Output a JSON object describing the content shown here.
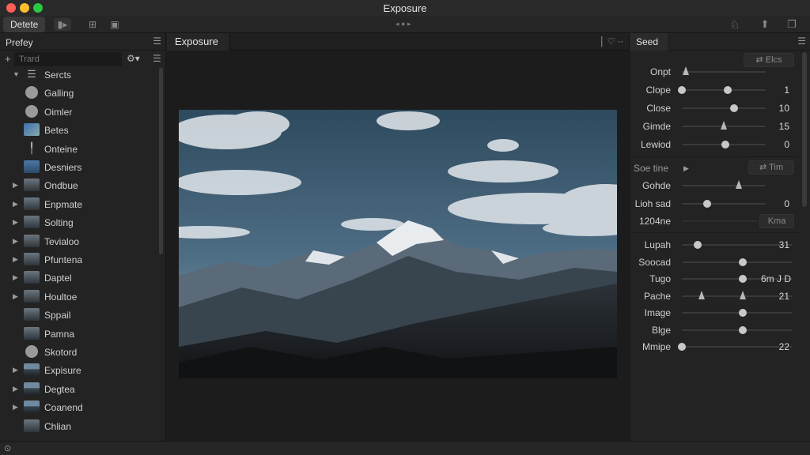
{
  "window": {
    "title": "Exposure"
  },
  "toolbar": {
    "tab_label": "Detete"
  },
  "library": {
    "title": "Prefey",
    "search": {
      "placeholder": "Trard"
    },
    "items": [
      {
        "label": "Sercts",
        "arrow": "down",
        "thumb": "list"
      },
      {
        "label": "Galling",
        "arrow": "",
        "thumb": "disc"
      },
      {
        "label": "Oimler",
        "arrow": "",
        "thumb": "disc"
      },
      {
        "label": "Betes",
        "arrow": "",
        "thumb": "cluster"
      },
      {
        "label": "Onteine",
        "arrow": "",
        "thumb": "pin"
      },
      {
        "label": "Desniers",
        "arrow": "",
        "thumb": "blue"
      },
      {
        "label": "Ondbue",
        "arrow": "right",
        "thumb": "photo"
      },
      {
        "label": "Enpmate",
        "arrow": "right",
        "thumb": "photo"
      },
      {
        "label": "Solting",
        "arrow": "right",
        "thumb": "photo"
      },
      {
        "label": "Tevialoo",
        "arrow": "right",
        "thumb": "photo"
      },
      {
        "label": "Pfuntena",
        "arrow": "right",
        "thumb": "photo"
      },
      {
        "label": "Daptel",
        "arrow": "right",
        "thumb": "photo"
      },
      {
        "label": "Houltoe",
        "arrow": "right",
        "thumb": "photo"
      },
      {
        "label": "Sppail",
        "arrow": "",
        "thumb": "photo"
      },
      {
        "label": "Pamna",
        "arrow": "",
        "thumb": "photo"
      },
      {
        "label": "Skotord",
        "arrow": "",
        "thumb": "disc"
      },
      {
        "label": "Expisure",
        "arrow": "right",
        "thumb": "mountain"
      },
      {
        "label": "Degtea",
        "arrow": "right",
        "thumb": "mountain"
      },
      {
        "label": "Coanend",
        "arrow": "right",
        "thumb": "mountain"
      },
      {
        "label": "Chlian",
        "arrow": "",
        "thumb": "photo"
      }
    ]
  },
  "viewer": {
    "tab_label": "Exposure"
  },
  "adjustments": {
    "tab_label": "Seed",
    "top_button": "Elcs",
    "sliders": [
      {
        "label": "Onpt",
        "control": "tri",
        "value": 0.05,
        "shown_value": ""
      },
      {
        "label": "Clope",
        "control": "knob",
        "value": 0.0,
        "second": 0.55,
        "shown_value": "1"
      },
      {
        "label": "Close",
        "control": "knob",
        "value": 0.62,
        "shown_value": "10"
      },
      {
        "label": "Gimde",
        "control": "tri",
        "value": 0.5,
        "shown_value": "15"
      },
      {
        "label": "Lewiod",
        "control": "knob",
        "value": 0.52,
        "shown_value": "0"
      }
    ],
    "section": {
      "label": "Soe tine",
      "button": "Tim"
    },
    "sliders2": [
      {
        "label": "Gohde",
        "control": "tri",
        "value": 0.68,
        "shown_value": ""
      },
      {
        "label": "Lioh sad",
        "control": "knob",
        "value": 0.3,
        "shown_value": "0"
      },
      {
        "label": "1204ne",
        "control": "none",
        "value": 0,
        "shown_value": ""
      }
    ],
    "button2": "Kma",
    "sliders3": [
      {
        "label": "Lupah",
        "control": "knob",
        "value": 0.14,
        "shown_value": "31"
      },
      {
        "label": "Soocad",
        "control": "knob",
        "value": 0.55,
        "shown_value": ""
      },
      {
        "label": "Tugo",
        "control": "knob",
        "value": 0.55,
        "shown_value": "6m  J D"
      },
      {
        "label": "Pache",
        "control": "tri",
        "value": 0.55,
        "second_tri": 0.18,
        "shown_value": "21"
      },
      {
        "label": "Image",
        "control": "knob",
        "value": 0.55,
        "shown_value": ""
      },
      {
        "label": "Blge",
        "control": "knob",
        "value": 0.55,
        "shown_value": ""
      },
      {
        "label": "Mmipe",
        "control": "knob",
        "value": 0.0,
        "shown_value": "22"
      }
    ]
  },
  "colors": {
    "accent": "#c8c8c8",
    "panel": "#232323",
    "canvas": "#1c1c1c"
  }
}
